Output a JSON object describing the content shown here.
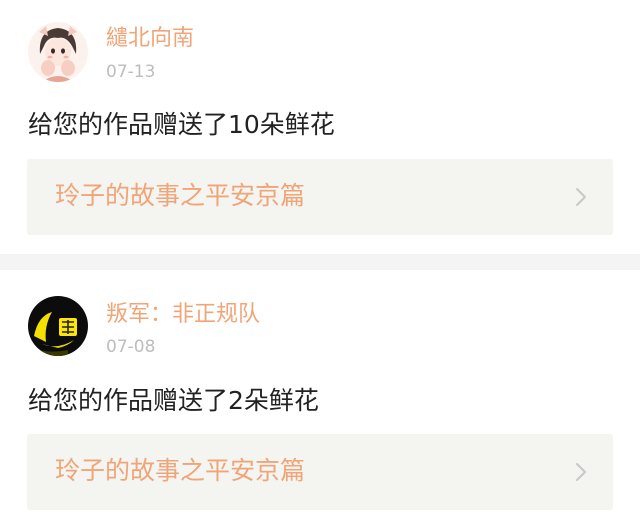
{
  "colors": {
    "accent": "#f0a578",
    "text": "#222222",
    "muted": "#bdbdbd",
    "link_bg": "#f4f4f1",
    "separator": "#f4f4f4"
  },
  "feed": [
    {
      "username": "繾北向南",
      "date": "07-13",
      "message": "给您的作品赠送了10朵鲜花",
      "work_title": "玲子的故事之平安京篇",
      "avatar_icon": "anime-girl-avatar-icon",
      "link_icon": "chevron-right-icon"
    },
    {
      "username": "叛军：非正规队",
      "date": "07-08",
      "message": "给您的作品赠送了2朵鲜花",
      "work_title": "玲子的故事之平安京篇",
      "avatar_icon": "dark-yellow-glow-avatar-icon",
      "link_icon": "chevron-right-icon"
    }
  ]
}
